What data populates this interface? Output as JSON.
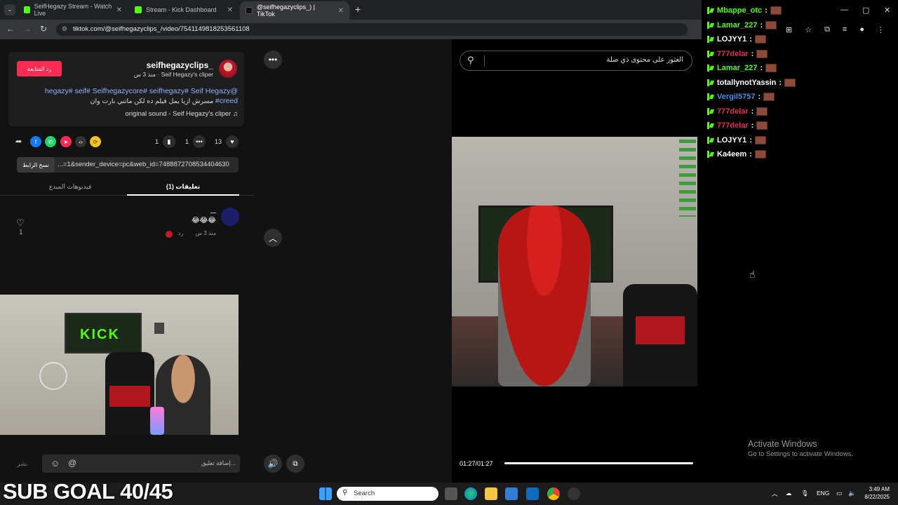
{
  "browser": {
    "tabs": [
      {
        "label": "SeifHegazy Stream - Watch Live",
        "icon": "kick-icon",
        "active": false
      },
      {
        "label": "Stream - Kick Dashboard",
        "icon": "kick-icon",
        "active": false
      },
      {
        "label": "@seifhegazyclips_) | TikTok",
        "icon": "tiktok-icon",
        "active": true
      }
    ],
    "new_tab": "+",
    "url": "tiktok.com/@seifhegazyclips_/video/7541149818253561108"
  },
  "post": {
    "username": "_seifhegazyclips",
    "subtitle": "Seif Hegazy's cliper · منذ 3 س",
    "follow_label": "رد المتابعة",
    "hashtags_line": "hegazy# seif# Seifhegazycore# seifhegazy# Seif Hegazy@",
    "caption_hash": "#creed",
    "caption_text": "مسرش ازيا يمل فيلم ده لكن ماتني بارت وان",
    "sound": "original sound - Seif Hegazy's cliper",
    "counts": {
      "likes": "13",
      "comments": "1",
      "saves": "1"
    },
    "link_text": "...=1&sender_device=pc&web_id=7488872708534404630",
    "copy_label": "نسخ الرابط",
    "tab_comments": "(1) تعليقات",
    "tab_creator": "فيديوهات المبدع",
    "comment": {
      "author": "ـــ",
      "text": "😂😂😂",
      "time": "منذ 3 س",
      "reply": "رد",
      "likes": "1"
    },
    "comment_placeholder": "إضافة تعليق...",
    "post_label": "نشر"
  },
  "player": {
    "search_placeholder": "العثور على محتوى ذي صلة",
    "time": "01:27/01:27",
    "progress": 1.0
  },
  "chat": [
    {
      "user": "Mbappe_otc",
      "color": "#53fc18"
    },
    {
      "user": "Lamar_227",
      "color": "#53fc18"
    },
    {
      "user": "LOJYY1",
      "color": "#ffffff"
    },
    {
      "user": "777delar",
      "color": "#e0334f"
    },
    {
      "user": "Lamar_227",
      "color": "#53fc18"
    },
    {
      "user": "totallynotYassin",
      "color": "#ffffff"
    },
    {
      "user": "Vergil5757",
      "color": "#4a90e2"
    },
    {
      "user": "777delar",
      "color": "#e0334f"
    },
    {
      "user": "777delar",
      "color": "#e0334f"
    },
    {
      "user": "LOJYY1",
      "color": "#ffffff"
    },
    {
      "user": "Ka4eem",
      "color": "#ffffff"
    }
  ],
  "overlay": {
    "sub_goal": "SUB GOAL 40/45",
    "activate_title": "Activate Windows",
    "activate_sub": "Go to Settings to activate Windows."
  },
  "taskbar": {
    "search_placeholder": "Search",
    "lang": "ENG",
    "time": "3:49 AM",
    "date": "8/22/2025"
  }
}
